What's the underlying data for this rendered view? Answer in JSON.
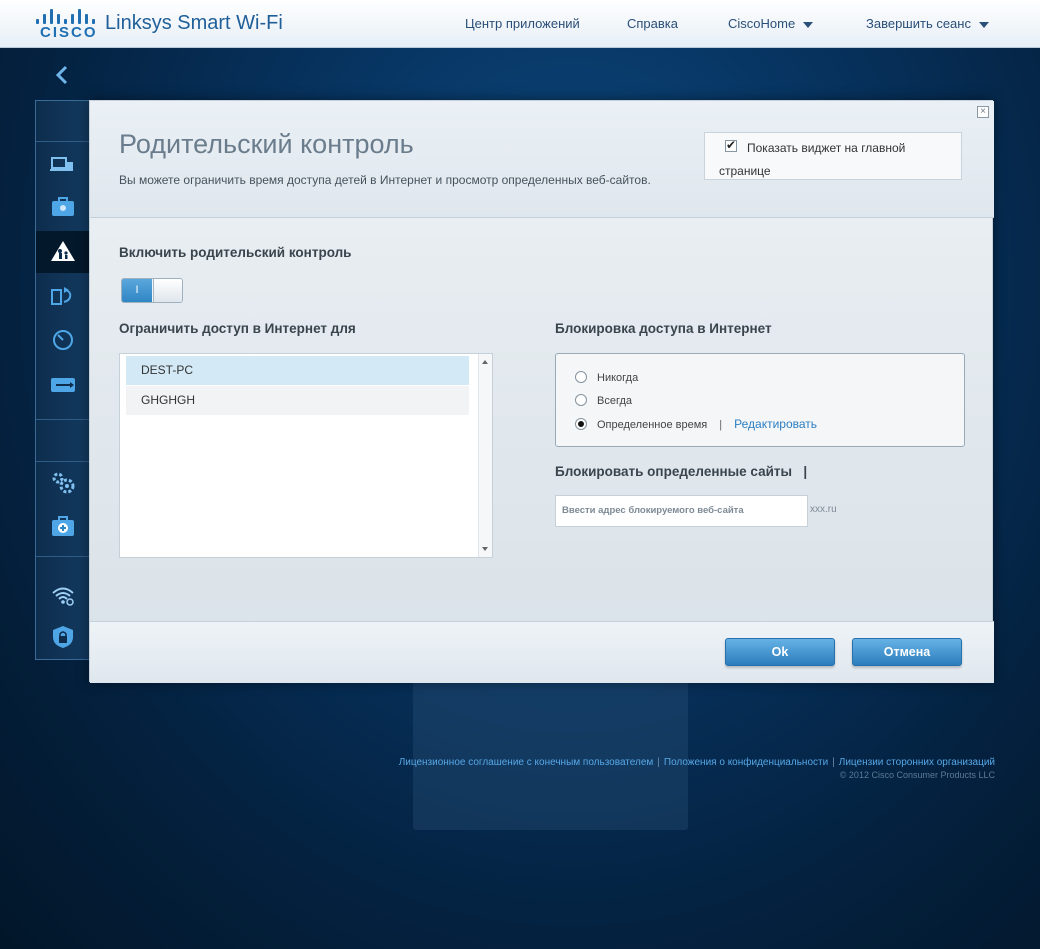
{
  "brand": {
    "logo_text": "CISCO",
    "product": "Linksys Smart Wi-Fi"
  },
  "topnav": {
    "app_center": "Центр приложений",
    "help": "Справка",
    "account": "CiscoHome",
    "logout": "Завершить сеанс"
  },
  "sidebar": {
    "icons": [
      "device-list-icon",
      "guest-access-icon",
      "parental-controls-icon",
      "media-prioritization-icon",
      "speed-test-icon",
      "usb-storage-icon",
      "router-settings-icon",
      "troubleshooting-icon",
      "wireless-icon",
      "security-icon"
    ],
    "active": "parental-controls-icon"
  },
  "modal": {
    "title": "Родительский контроль",
    "subtitle": "Вы можете ограничить время доступа детей в Интернет и просмотр определенных веб-сайтов.",
    "widget_checkbox_label": "Показать виджет на главной странице",
    "widget_checked": true,
    "enable_label": "Включить родительский контроль",
    "toggle_on_text": "I",
    "restrict_label": "Ограничить доступ в Интернет для",
    "devices": [
      "DEST-PC",
      "GHGHGH"
    ],
    "selected_device": "DEST-PC",
    "block_access_label": "Блокировка доступа в Интернет",
    "block_options": [
      "Никогда",
      "Всегда",
      "Определенное время"
    ],
    "block_selected": "Определенное время",
    "edit_link": "Редактировать",
    "block_sites_label": "Блокировать определенные сайты",
    "block_sites_pipe": "|",
    "site_input_placeholder": "Ввести адрес блокируемого веб-сайта",
    "site_hint": "xxx.ru",
    "ok_button": "Ok",
    "cancel_button": "Отмена",
    "close_button": "×"
  },
  "footer": {
    "eula": "Лицензионное соглашение с конечным пользователем",
    "privacy": "Положения о конфиденциальности",
    "third_party": "Лицензии сторонних организаций",
    "copyright": "© 2012 Cisco Consumer Products LLC"
  },
  "colors": {
    "accent": "#2f86c4",
    "link": "#2b7ec1",
    "background": "#073461"
  }
}
